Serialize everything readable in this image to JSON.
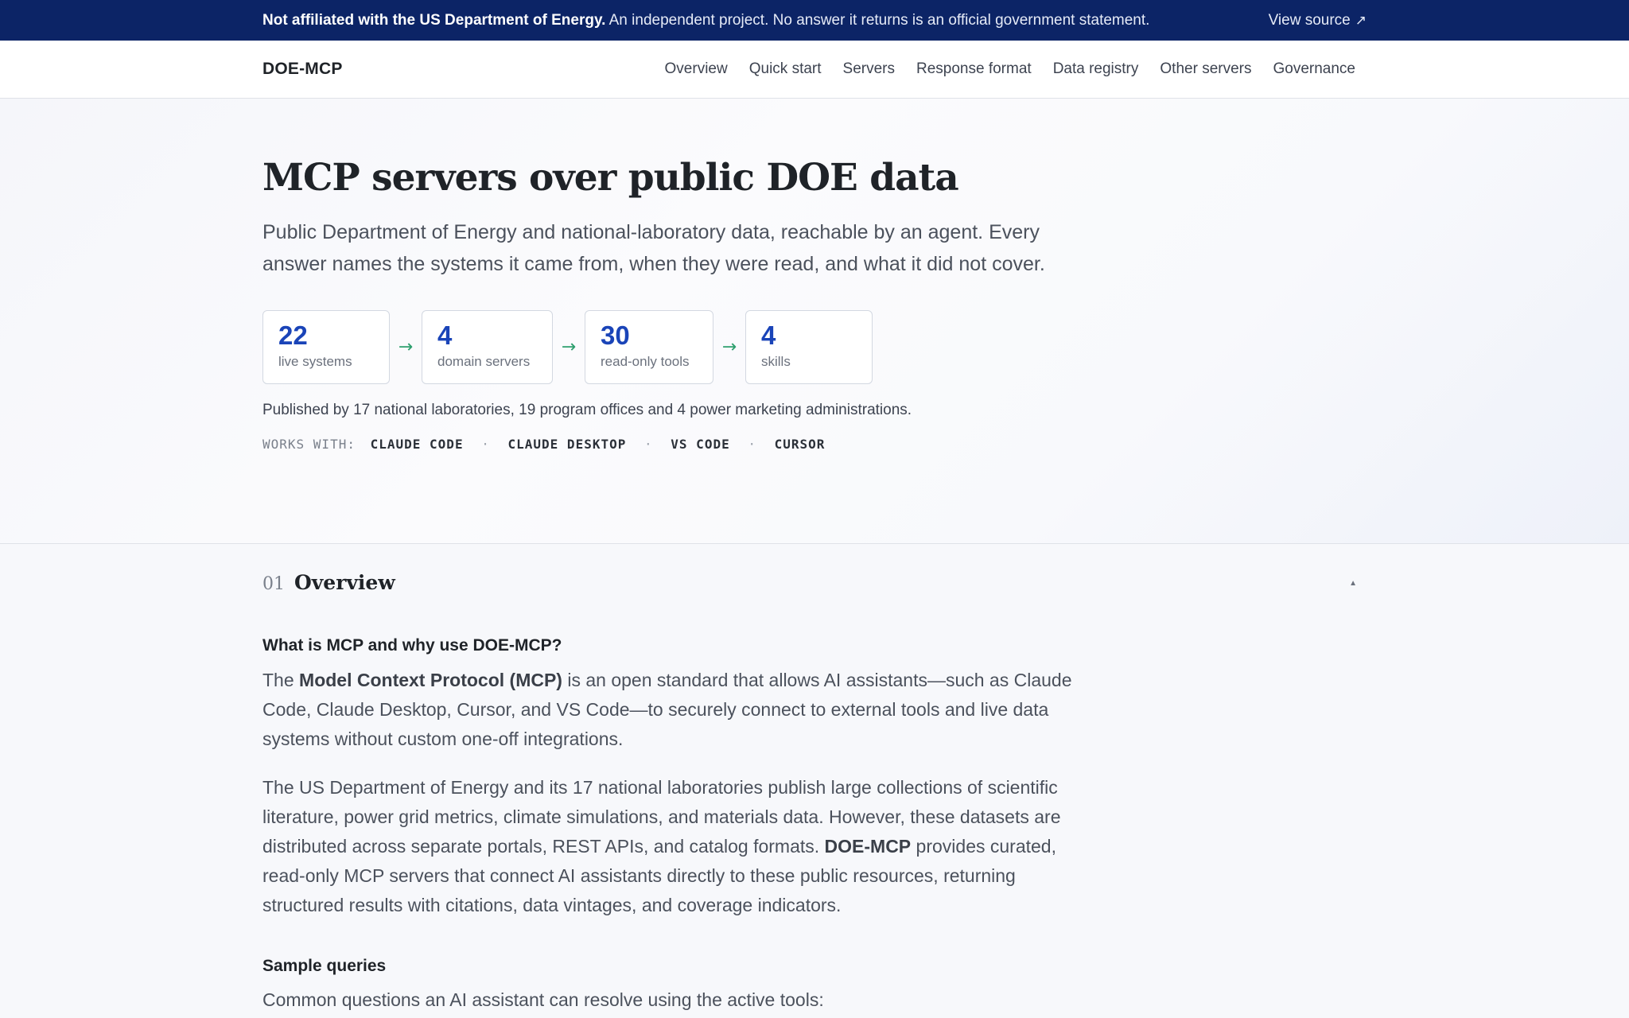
{
  "banner": {
    "notice_bold": "Not affiliated with the US Department of Energy.",
    "notice_rest": " An independent project. No answer it returns is an official government statement.",
    "view_source": "View source",
    "view_source_icon": "↗"
  },
  "nav": {
    "brand": "DOE-MCP",
    "links": [
      "Overview",
      "Quick start",
      "Servers",
      "Response format",
      "Data registry",
      "Other servers",
      "Governance"
    ]
  },
  "hero": {
    "title": "MCP servers over public DOE data",
    "lede": "Public Department of Energy and national-laboratory data, reachable by an agent. Every answer names the systems it came from, when they were read, and what it did not cover.",
    "stats": [
      {
        "value": "22",
        "label": "live systems"
      },
      {
        "value": "4",
        "label": "domain servers"
      },
      {
        "value": "30",
        "label": "read-only tools"
      },
      {
        "value": "4",
        "label": "skills"
      }
    ],
    "arrow_icon": "→",
    "published": "Published by 17 national laboratories, 19 program offices and 4 power marketing administrations.",
    "works_label": "WORKS WITH:",
    "clients": [
      "CLAUDE CODE",
      "CLAUDE DESKTOP",
      "VS CODE",
      "CURSOR"
    ],
    "separator": "·"
  },
  "overview": {
    "number": "01",
    "title": "Overview",
    "collapse_icon": "▲",
    "q_heading": "What is MCP and why use DOE-MCP?",
    "p1_pre": "The ",
    "p1_bold": "Model Context Protocol (MCP)",
    "p1_post": " is an open standard that allows AI assistants—such as Claude Code, Claude Desktop, Cursor, and VS Code—to securely connect to external tools and live data systems without custom one-off integrations.",
    "p2_pre": "The US Department of Energy and its 17 national laboratories publish large collections of scientific literature, power grid metrics, climate simulations, and materials data. However, these datasets are distributed across separate portals, REST APIs, and catalog formats. ",
    "p2_bold": "DOE-MCP",
    "p2_post": " provides curated, read-only MCP servers that connect AI assistants directly to these public resources, returning structured results with citations, data vintages, and coverage indicators.",
    "sample_heading": "Sample queries",
    "sample_intro": "Common questions an AI assistant can resolve using the active tools:"
  }
}
